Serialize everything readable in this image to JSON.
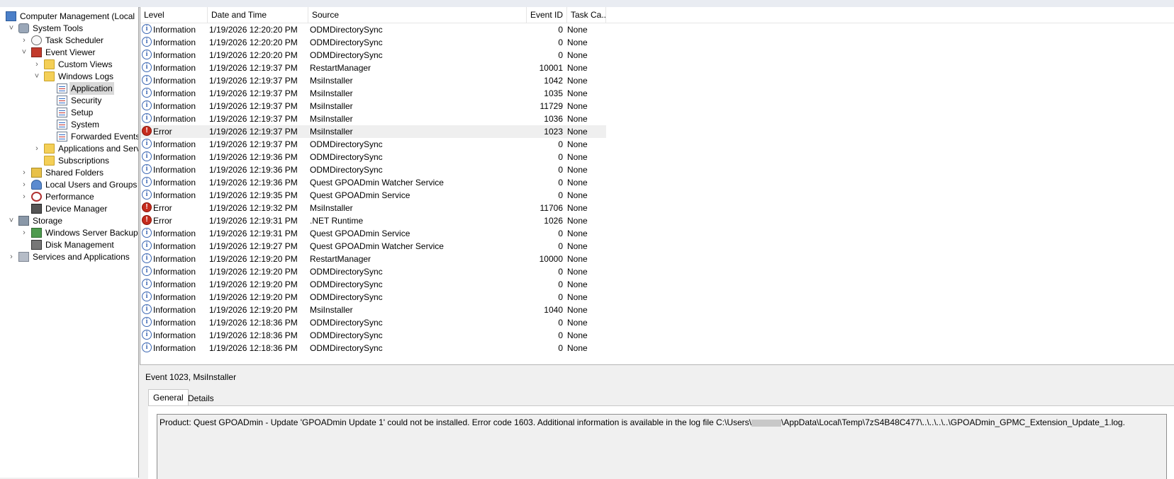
{
  "tree": {
    "items": [
      {
        "label": "Computer Management (Local",
        "twisty": "",
        "icon": "computer-management-icon"
      },
      {
        "label": "System Tools",
        "twisty": "v",
        "icon": "system-tools-icon"
      },
      {
        "label": "Task Scheduler",
        "twisty": ">",
        "icon": "task-scheduler-icon"
      },
      {
        "label": "Event Viewer",
        "twisty": "v",
        "icon": "event-viewer-icon"
      },
      {
        "label": "Custom Views",
        "twisty": ">",
        "icon": "folder-icon"
      },
      {
        "label": "Windows Logs",
        "twisty": "v",
        "icon": "folder-icon"
      },
      {
        "label": "Application",
        "twisty": "",
        "icon": "log-icon"
      },
      {
        "label": "Security",
        "twisty": "",
        "icon": "log-icon"
      },
      {
        "label": "Setup",
        "twisty": "",
        "icon": "log-icon"
      },
      {
        "label": "System",
        "twisty": "",
        "icon": "log-icon"
      },
      {
        "label": "Forwarded Events",
        "twisty": "",
        "icon": "log-icon"
      },
      {
        "label": "Applications and Services Logs",
        "twisty": ">",
        "icon": "folder-icon"
      },
      {
        "label": "Subscriptions",
        "twisty": "",
        "icon": "folder-icon"
      },
      {
        "label": "Shared Folders",
        "twisty": ">",
        "icon": "shared-folders-icon"
      },
      {
        "label": "Local Users and Groups",
        "twisty": ">",
        "icon": "users-icon"
      },
      {
        "label": "Performance",
        "twisty": ">",
        "icon": "performance-icon"
      },
      {
        "label": "Device Manager",
        "twisty": "",
        "icon": "device-manager-icon"
      },
      {
        "label": "Storage",
        "twisty": "v",
        "icon": "storage-icon"
      },
      {
        "label": "Windows Server Backup",
        "twisty": ">",
        "icon": "backup-icon"
      },
      {
        "label": "Disk Management",
        "twisty": "",
        "icon": "disk-icon"
      },
      {
        "label": "Services and Applications",
        "twisty": ">",
        "icon": "services-icon"
      }
    ]
  },
  "list": {
    "columns": {
      "level": "Level",
      "date": "Date and Time",
      "source": "Source",
      "event_id": "Event ID",
      "task": "Task Ca..."
    },
    "rows": [
      {
        "level": "Information",
        "date": "1/19/2026 12:20:20 PM",
        "source": "ODMDirectorySync",
        "event_id": "0",
        "task": "None"
      },
      {
        "level": "Information",
        "date": "1/19/2026 12:20:20 PM",
        "source": "ODMDirectorySync",
        "event_id": "0",
        "task": "None"
      },
      {
        "level": "Information",
        "date": "1/19/2026 12:20:20 PM",
        "source": "ODMDirectorySync",
        "event_id": "0",
        "task": "None"
      },
      {
        "level": "Information",
        "date": "1/19/2026 12:19:37 PM",
        "source": "RestartManager",
        "event_id": "10001",
        "task": "None"
      },
      {
        "level": "Information",
        "date": "1/19/2026 12:19:37 PM",
        "source": "MsiInstaller",
        "event_id": "1042",
        "task": "None"
      },
      {
        "level": "Information",
        "date": "1/19/2026 12:19:37 PM",
        "source": "MsiInstaller",
        "event_id": "1035",
        "task": "None"
      },
      {
        "level": "Information",
        "date": "1/19/2026 12:19:37 PM",
        "source": "MsiInstaller",
        "event_id": "11729",
        "task": "None"
      },
      {
        "level": "Information",
        "date": "1/19/2026 12:19:37 PM",
        "source": "MsiInstaller",
        "event_id": "1036",
        "task": "None"
      },
      {
        "level": "Error",
        "date": "1/19/2026 12:19:37 PM",
        "source": "MsiInstaller",
        "event_id": "1023",
        "task": "None"
      },
      {
        "level": "Information",
        "date": "1/19/2026 12:19:37 PM",
        "source": "ODMDirectorySync",
        "event_id": "0",
        "task": "None"
      },
      {
        "level": "Information",
        "date": "1/19/2026 12:19:36 PM",
        "source": "ODMDirectorySync",
        "event_id": "0",
        "task": "None"
      },
      {
        "level": "Information",
        "date": "1/19/2026 12:19:36 PM",
        "source": "ODMDirectorySync",
        "event_id": "0",
        "task": "None"
      },
      {
        "level": "Information",
        "date": "1/19/2026 12:19:36 PM",
        "source": "Quest GPOADmin Watcher Service",
        "event_id": "0",
        "task": "None"
      },
      {
        "level": "Information",
        "date": "1/19/2026 12:19:35 PM",
        "source": "Quest GPOADmin Service",
        "event_id": "0",
        "task": "None"
      },
      {
        "level": "Error",
        "date": "1/19/2026 12:19:32 PM",
        "source": "MsiInstaller",
        "event_id": "11706",
        "task": "None"
      },
      {
        "level": "Error",
        "date": "1/19/2026 12:19:31 PM",
        "source": ".NET Runtime",
        "event_id": "1026",
        "task": "None"
      },
      {
        "level": "Information",
        "date": "1/19/2026 12:19:31 PM",
        "source": "Quest GPOADmin Service",
        "event_id": "0",
        "task": "None"
      },
      {
        "level": "Information",
        "date": "1/19/2026 12:19:27 PM",
        "source": "Quest GPOADmin Watcher Service",
        "event_id": "0",
        "task": "None"
      },
      {
        "level": "Information",
        "date": "1/19/2026 12:19:20 PM",
        "source": "RestartManager",
        "event_id": "10000",
        "task": "None"
      },
      {
        "level": "Information",
        "date": "1/19/2026 12:19:20 PM",
        "source": "ODMDirectorySync",
        "event_id": "0",
        "task": "None"
      },
      {
        "level": "Information",
        "date": "1/19/2026 12:19:20 PM",
        "source": "ODMDirectorySync",
        "event_id": "0",
        "task": "None"
      },
      {
        "level": "Information",
        "date": "1/19/2026 12:19:20 PM",
        "source": "ODMDirectorySync",
        "event_id": "0",
        "task": "None"
      },
      {
        "level": "Information",
        "date": "1/19/2026 12:19:20 PM",
        "source": "MsiInstaller",
        "event_id": "1040",
        "task": "None"
      },
      {
        "level": "Information",
        "date": "1/19/2026 12:18:36 PM",
        "source": "ODMDirectorySync",
        "event_id": "0",
        "task": "None"
      },
      {
        "level": "Information",
        "date": "1/19/2026 12:18:36 PM",
        "source": "ODMDirectorySync",
        "event_id": "0",
        "task": "None"
      },
      {
        "level": "Information",
        "date": "1/19/2026 12:18:36 PM",
        "source": "ODMDirectorySync",
        "event_id": "0",
        "task": "None"
      }
    ]
  },
  "detail": {
    "title": "Event 1023, MsiInstaller",
    "tabs": {
      "general": "General",
      "details": "Details"
    },
    "message_before": "Product: Quest GPOADmin - Update 'GPOADmin Update 1' could not be installed. Error code 1603. Additional information is available in the log file C:\\Users\\",
    "message_after": "\\AppData\\Local\\Temp\\7zS4B48C477\\..\\..\\..\\..\\GPOADmin_GPMC_Extension_Update_1.log."
  }
}
